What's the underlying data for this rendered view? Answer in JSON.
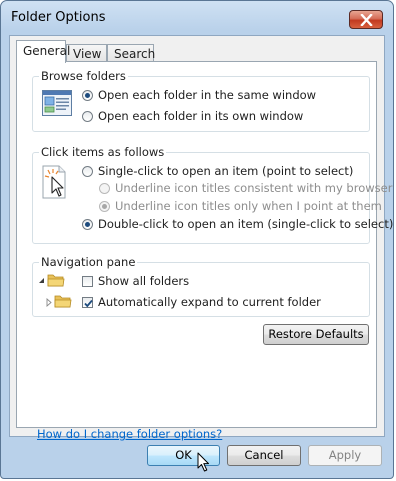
{
  "window": {
    "title": "Folder Options"
  },
  "tabs": [
    {
      "label": "General",
      "active": true
    },
    {
      "label": "View",
      "active": false
    },
    {
      "label": "Search",
      "active": false
    }
  ],
  "browse_folders": {
    "label": "Browse folders",
    "options": [
      {
        "label": "Open each folder in the same window",
        "checked": true
      },
      {
        "label": "Open each folder in its own window",
        "checked": false
      }
    ]
  },
  "click_items": {
    "label": "Click items as follows",
    "single_click": {
      "label": "Single-click to open an item (point to select)",
      "checked": false
    },
    "underline_consistent": {
      "label": "Underline icon titles consistent with my browser",
      "checked": false,
      "enabled": false
    },
    "underline_point": {
      "label": "Underline icon titles only when I point at them",
      "checked": true,
      "enabled": false
    },
    "double_click": {
      "label": "Double-click to open an item (single-click to select)",
      "checked": true
    }
  },
  "navigation_pane": {
    "label": "Navigation pane",
    "show_all_folders": {
      "label": "Show all folders",
      "checked": false
    },
    "auto_expand": {
      "label": "Automatically expand to current folder",
      "checked": true
    }
  },
  "buttons": {
    "restore_defaults": "Restore Defaults",
    "ok": "OK",
    "cancel": "Cancel",
    "apply": "Apply"
  },
  "help_link": "How do I change folder options?",
  "icons": {
    "close": "close-icon",
    "browse": "window-preview-icon",
    "click": "pointer-click-icon",
    "tree_expanded": "tree-expanded-arrow-icon",
    "tree_collapsed": "tree-collapsed-arrow-icon",
    "folder": "folder-icon",
    "cursor": "mouse-cursor-icon"
  },
  "colors": {
    "window_frame": "#b9d1ea",
    "link": "#0066cc",
    "close_button": "#c23a20",
    "default_button": "#bee6fd"
  }
}
